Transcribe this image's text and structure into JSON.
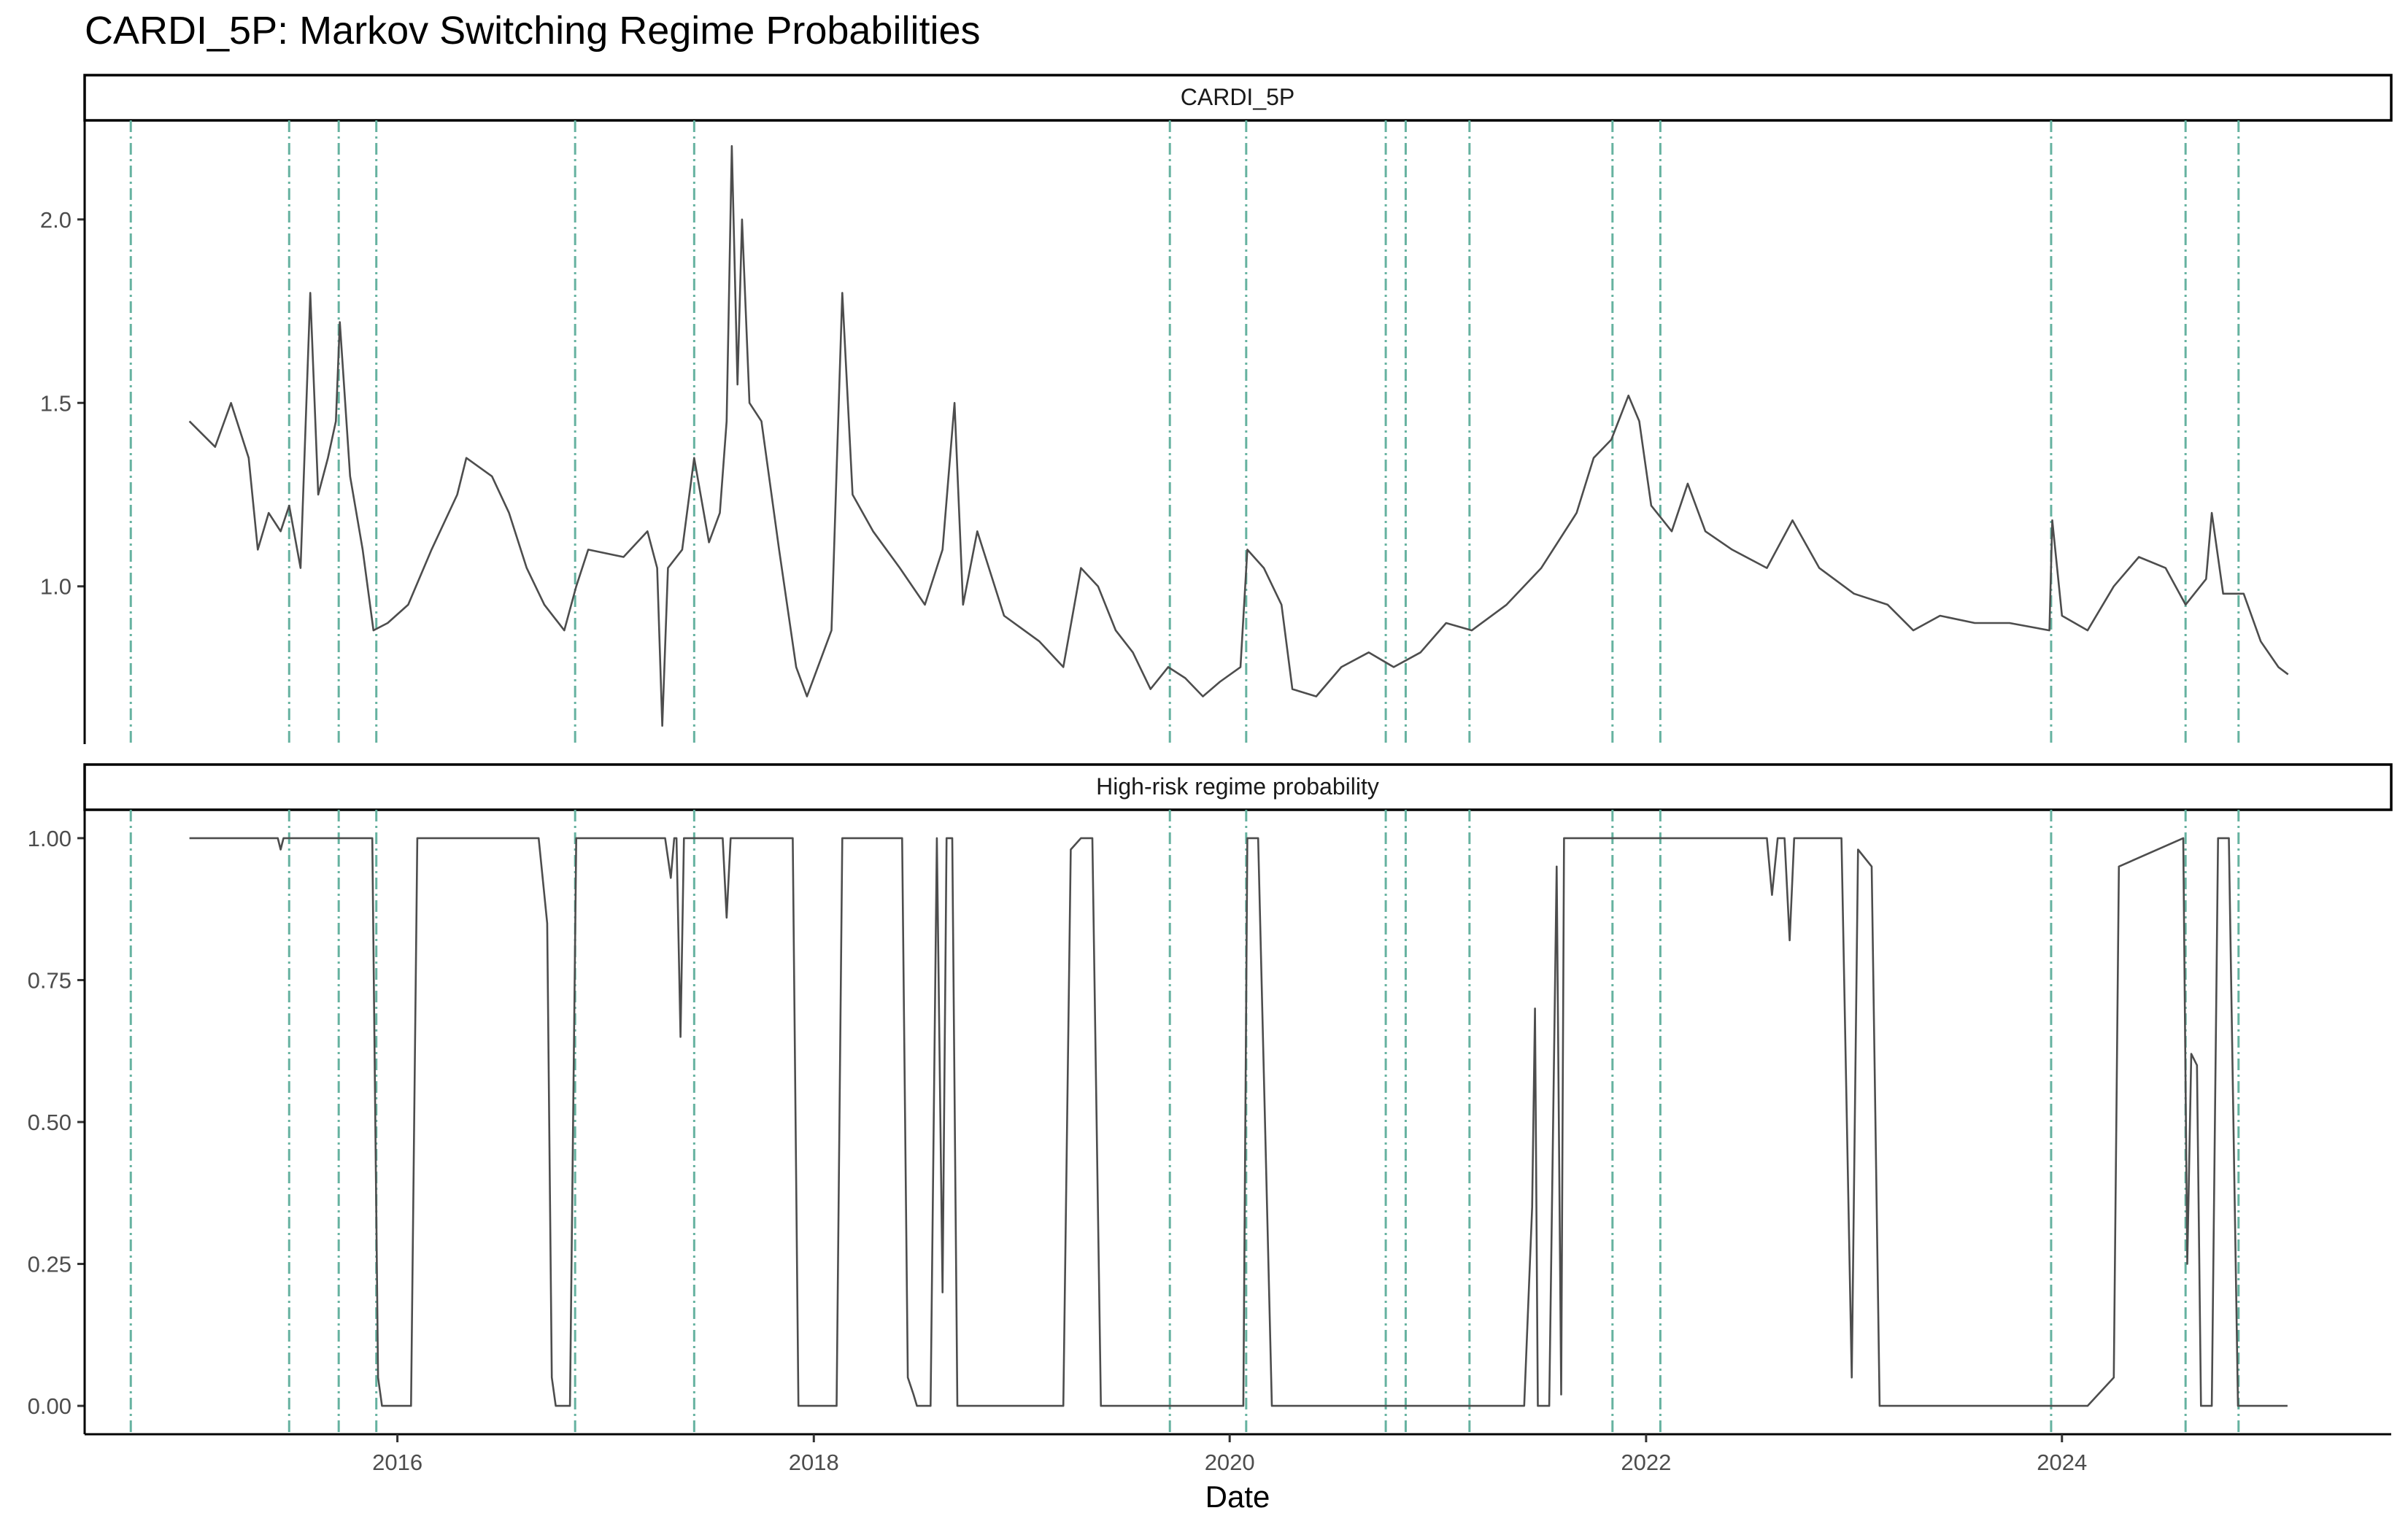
{
  "chart_data": {
    "type": "line",
    "title": "CARDI_5P: Markov Switching Regime Probabilities",
    "xlabel": "Date",
    "x_ticks": [
      "2016",
      "2018",
      "2020",
      "2022",
      "2024"
    ],
    "x_range": [
      "2014-07-01",
      "2025-08-01"
    ],
    "colors": {
      "line": "#4d4d4d",
      "vline": "#66b2a0",
      "axis": "#000000"
    },
    "event_dates": [
      "2014-09-20",
      "2015-06-25",
      "2015-09-20",
      "2015-11-25",
      "2016-11-08",
      "2017-06-05",
      "2019-09-18",
      "2020-01-30",
      "2020-10-01",
      "2020-11-05",
      "2021-02-25",
      "2021-11-03",
      "2022-01-26",
      "2023-12-13",
      "2024-08-05",
      "2024-11-06"
    ],
    "panels": [
      {
        "strip": "CARDI_5P",
        "ylabel": "",
        "ylim": [
          0.57,
          2.27
        ],
        "y_ticks": [
          "1.0",
          "1.5",
          "2.0"
        ],
        "y_tick_values": [
          1.0,
          1.5,
          2.0
        ],
        "series": [
          {
            "points": [
              [
                "2015-01-01",
                1.45
              ],
              [
                "2015-02-15",
                1.38
              ],
              [
                "2015-03-15",
                1.5
              ],
              [
                "2015-04-15",
                1.35
              ],
              [
                "2015-05-01",
                1.1
              ],
              [
                "2015-05-20",
                1.2
              ],
              [
                "2015-06-10",
                1.15
              ],
              [
                "2015-06-25",
                1.22
              ],
              [
                "2015-07-15",
                1.05
              ],
              [
                "2015-08-01",
                1.8
              ],
              [
                "2015-08-15",
                1.25
              ],
              [
                "2015-09-01",
                1.35
              ],
              [
                "2015-09-15",
                1.45
              ],
              [
                "2015-09-22",
                1.72
              ],
              [
                "2015-10-10",
                1.3
              ],
              [
                "2015-11-01",
                1.1
              ],
              [
                "2015-11-20",
                0.88
              ],
              [
                "2015-12-15",
                0.9
              ],
              [
                "2016-01-20",
                0.95
              ],
              [
                "2016-03-01",
                1.1
              ],
              [
                "2016-04-15",
                1.25
              ],
              [
                "2016-05-01",
                1.35
              ],
              [
                "2016-06-15",
                1.3
              ],
              [
                "2016-07-15",
                1.2
              ],
              [
                "2016-08-15",
                1.05
              ],
              [
                "2016-09-15",
                0.95
              ],
              [
                "2016-10-20",
                0.88
              ],
              [
                "2016-11-10",
                1.0
              ],
              [
                "2016-12-01",
                1.1
              ],
              [
                "2017-02-01",
                1.08
              ],
              [
                "2017-03-15",
                1.15
              ],
              [
                "2017-04-01",
                1.05
              ],
              [
                "2017-04-10",
                0.62
              ],
              [
                "2017-04-20",
                1.05
              ],
              [
                "2017-05-15",
                1.1
              ],
              [
                "2017-06-05",
                1.35
              ],
              [
                "2017-07-01",
                1.12
              ],
              [
                "2017-07-20",
                1.2
              ],
              [
                "2017-08-01",
                1.45
              ],
              [
                "2017-08-10",
                2.2
              ],
              [
                "2017-08-20",
                1.55
              ],
              [
                "2017-08-28",
                2.0
              ],
              [
                "2017-09-10",
                1.5
              ],
              [
                "2017-10-01",
                1.45
              ],
              [
                "2017-11-01",
                1.1
              ],
              [
                "2017-12-01",
                0.78
              ],
              [
                "2017-12-20",
                0.7
              ],
              [
                "2018-02-01",
                0.88
              ],
              [
                "2018-02-20",
                1.8
              ],
              [
                "2018-03-10",
                1.25
              ],
              [
                "2018-04-15",
                1.15
              ],
              [
                "2018-06-01",
                1.05
              ],
              [
                "2018-07-15",
                0.95
              ],
              [
                "2018-08-15",
                1.1
              ],
              [
                "2018-09-05",
                1.5
              ],
              [
                "2018-09-20",
                0.95
              ],
              [
                "2018-10-15",
                1.15
              ],
              [
                "2018-12-01",
                0.92
              ],
              [
                "2019-02-01",
                0.85
              ],
              [
                "2019-03-15",
                0.78
              ],
              [
                "2019-04-15",
                1.05
              ],
              [
                "2019-05-15",
                1.0
              ],
              [
                "2019-06-15",
                0.88
              ],
              [
                "2019-07-15",
                0.82
              ],
              [
                "2019-08-15",
                0.72
              ],
              [
                "2019-09-15",
                0.78
              ],
              [
                "2019-10-15",
                0.75
              ],
              [
                "2019-11-15",
                0.7
              ],
              [
                "2019-12-15",
                0.74
              ],
              [
                "2020-01-20",
                0.78
              ],
              [
                "2020-02-01",
                1.1
              ],
              [
                "2020-03-01",
                1.05
              ],
              [
                "2020-04-01",
                0.95
              ],
              [
                "2020-04-20",
                0.72
              ],
              [
                "2020-06-01",
                0.7
              ],
              [
                "2020-07-15",
                0.78
              ],
              [
                "2020-09-01",
                0.82
              ],
              [
                "2020-10-15",
                0.78
              ],
              [
                "2020-12-01",
                0.82
              ],
              [
                "2021-01-15",
                0.9
              ],
              [
                "2021-03-01",
                0.88
              ],
              [
                "2021-05-01",
                0.95
              ],
              [
                "2021-07-01",
                1.05
              ],
              [
                "2021-09-01",
                1.2
              ],
              [
                "2021-10-01",
                1.35
              ],
              [
                "2021-11-01",
                1.4
              ],
              [
                "2021-12-01",
                1.52
              ],
              [
                "2021-12-20",
                1.45
              ],
              [
                "2022-01-10",
                1.22
              ],
              [
                "2022-02-15",
                1.15
              ],
              [
                "2022-03-15",
                1.28
              ],
              [
                "2022-04-15",
                1.15
              ],
              [
                "2022-06-01",
                1.1
              ],
              [
                "2022-08-01",
                1.05
              ],
              [
                "2022-09-15",
                1.18
              ],
              [
                "2022-11-01",
                1.05
              ],
              [
                "2023-01-01",
                0.98
              ],
              [
                "2023-03-01",
                0.95
              ],
              [
                "2023-04-15",
                0.88
              ],
              [
                "2023-06-01",
                0.92
              ],
              [
                "2023-08-01",
                0.9
              ],
              [
                "2023-10-01",
                0.9
              ],
              [
                "2023-12-10",
                0.88
              ],
              [
                "2023-12-15",
                1.18
              ],
              [
                "2024-01-01",
                0.92
              ],
              [
                "2024-02-15",
                0.88
              ],
              [
                "2024-04-01",
                1.0
              ],
              [
                "2024-05-15",
                1.08
              ],
              [
                "2024-07-01",
                1.05
              ],
              [
                "2024-08-05",
                0.95
              ],
              [
                "2024-09-10",
                1.02
              ],
              [
                "2024-09-20",
                1.2
              ],
              [
                "2024-10-10",
                0.98
              ],
              [
                "2024-11-15",
                0.98
              ],
              [
                "2024-12-15",
                0.85
              ],
              [
                "2025-01-15",
                0.78
              ],
              [
                "2025-02-01",
                0.76
              ]
            ]
          }
        ]
      },
      {
        "strip": "High-risk regime probability",
        "ylabel": "",
        "ylim": [
          -0.05,
          1.05
        ],
        "y_ticks": [
          "0.00",
          "0.25",
          "0.50",
          "0.75",
          "1.00"
        ],
        "y_tick_values": [
          0.0,
          0.25,
          0.5,
          0.75,
          1.0
        ],
        "series": [
          {
            "points": [
              [
                "2015-01-01",
                1.0
              ],
              [
                "2015-06-05",
                1.0
              ],
              [
                "2015-06-10",
                0.98
              ],
              [
                "2015-06-15",
                1.0
              ],
              [
                "2015-11-18",
                1.0
              ],
              [
                "2015-11-28",
                0.05
              ],
              [
                "2015-12-05",
                0.0
              ],
              [
                "2016-01-25",
                0.0
              ],
              [
                "2016-02-05",
                1.0
              ],
              [
                "2016-09-05",
                1.0
              ],
              [
                "2016-09-20",
                0.85
              ],
              [
                "2016-09-28",
                0.05
              ],
              [
                "2016-10-05",
                0.0
              ],
              [
                "2016-10-30",
                0.0
              ],
              [
                "2016-11-10",
                1.0
              ],
              [
                "2017-04-15",
                1.0
              ],
              [
                "2017-04-25",
                0.93
              ],
              [
                "2017-05-01",
                1.0
              ],
              [
                "2017-05-05",
                1.0
              ],
              [
                "2017-05-12",
                0.65
              ],
              [
                "2017-05-18",
                1.0
              ],
              [
                "2017-07-25",
                1.0
              ],
              [
                "2017-08-01",
                0.86
              ],
              [
                "2017-08-08",
                1.0
              ],
              [
                "2017-11-25",
                1.0
              ],
              [
                "2017-12-05",
                0.0
              ],
              [
                "2018-02-10",
                0.0
              ],
              [
                "2018-02-20",
                1.0
              ],
              [
                "2018-06-05",
                1.0
              ],
              [
                "2018-06-15",
                0.05
              ],
              [
                "2018-06-25",
                0.02
              ],
              [
                "2018-07-01",
                0.0
              ],
              [
                "2018-07-25",
                0.0
              ],
              [
                "2018-08-05",
                1.0
              ],
              [
                "2018-08-15",
                0.2
              ],
              [
                "2018-08-22",
                1.0
              ],
              [
                "2018-09-01",
                1.0
              ],
              [
                "2018-09-10",
                0.0
              ],
              [
                "2019-03-15",
                0.0
              ],
              [
                "2019-03-28",
                0.98
              ],
              [
                "2019-04-15",
                1.0
              ],
              [
                "2019-05-05",
                1.0
              ],
              [
                "2019-05-20",
                0.0
              ],
              [
                "2020-01-25",
                0.0
              ],
              [
                "2020-02-01",
                1.0
              ],
              [
                "2020-02-20",
                1.0
              ],
              [
                "2020-03-15",
                0.0
              ],
              [
                "2021-06-01",
                0.0
              ],
              [
                "2021-06-15",
                0.35
              ],
              [
                "2021-06-20",
                0.7
              ],
              [
                "2021-06-25",
                0.0
              ],
              [
                "2021-07-15",
                0.0
              ],
              [
                "2021-07-28",
                0.95
              ],
              [
                "2021-08-05",
                0.02
              ],
              [
                "2021-08-10",
                1.0
              ],
              [
                "2022-08-01",
                1.0
              ],
              [
                "2022-08-10",
                0.9
              ],
              [
                "2022-08-20",
                1.0
              ],
              [
                "2022-09-01",
                1.0
              ],
              [
                "2022-09-10",
                0.82
              ],
              [
                "2022-09-18",
                1.0
              ],
              [
                "2022-12-10",
                1.0
              ],
              [
                "2022-12-28",
                0.05
              ],
              [
                "2023-01-08",
                0.98
              ],
              [
                "2023-02-01",
                0.95
              ],
              [
                "2023-02-15",
                0.0
              ],
              [
                "2023-12-13",
                0.0
              ],
              [
                "2024-02-15",
                0.0
              ],
              [
                "2024-04-01",
                0.05
              ],
              [
                "2024-04-10",
                0.95
              ],
              [
                "2024-08-01",
                1.0
              ],
              [
                "2024-08-08",
                0.25
              ],
              [
                "2024-08-15",
                0.62
              ],
              [
                "2024-08-25",
                0.6
              ],
              [
                "2024-09-01",
                0.0
              ],
              [
                "2024-09-20",
                0.0
              ],
              [
                "2024-10-01",
                1.0
              ],
              [
                "2024-10-20",
                1.0
              ],
              [
                "2024-11-05",
                0.0
              ],
              [
                "2025-01-31",
                0.0
              ]
            ]
          }
        ]
      }
    ]
  }
}
